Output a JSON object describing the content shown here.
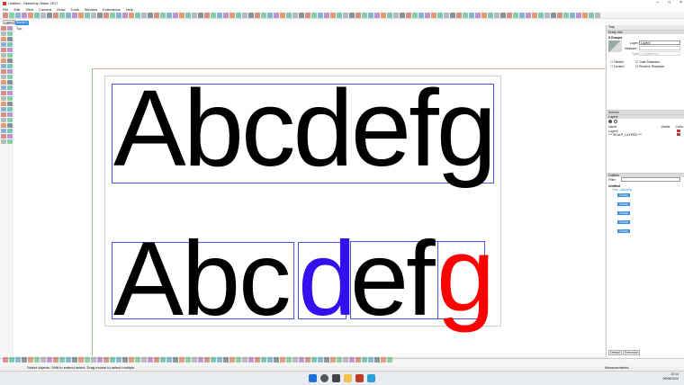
{
  "app": {
    "title": "Untitled - SketchUp Make 2017"
  },
  "menu": [
    "File",
    "Edit",
    "View",
    "Camera",
    "Draw",
    "Tools",
    "Window",
    "Extensions",
    "Help"
  ],
  "layer_select": "Layer0",
  "scene_tab": "Scene 1",
  "viewport": {
    "view_label": "Top",
    "text_top": "Abcdefg",
    "text_bottom": {
      "a": "Abc",
      "b": "d",
      "c": "ef",
      "d": "g"
    }
  },
  "colors": {
    "blue_glyph": "#3311ee",
    "red_glyph": "#ff0000",
    "accent": "#3a8ee6"
  },
  "right_panel": {
    "tray_title": "Tray",
    "entity_info": {
      "header": "Entity Info",
      "group_count": "8 Groups",
      "layer_label": "Layer:",
      "layer_value": "Layer0",
      "instance_label": "Instance:",
      "type_label": "Type:",
      "type_value": "<Undefined>",
      "hidden": "Hidden",
      "locked": "Locked",
      "cast_shadows": "Cast Shadows",
      "receive_shadows": "Receive Shadows"
    },
    "scenes_header": "Scenes",
    "layers": {
      "header": "Layers",
      "columns": [
        "Name",
        "Visible",
        "Color"
      ],
      "rows": [
        {
          "name": "Layer0"
        },
        {
          "name": "*** SKALP_LAYERS ***"
        }
      ]
    },
    "outliner": {
      "header": "Outliner",
      "filter_label": "Filter:",
      "root": "Untitled",
      "group": "Text - abcdefg",
      "items": [
        "Group",
        "Group",
        "Group",
        "Group",
        "Group"
      ]
    },
    "tabs": [
      "Default",
      "Extension"
    ]
  },
  "status": {
    "hint": "Select objects. Shift to extend select. Drag mouse to select multiple.",
    "measurements_label": "Measurements"
  },
  "taskbar": {
    "time": "23:14",
    "date": "09/06/2024"
  }
}
